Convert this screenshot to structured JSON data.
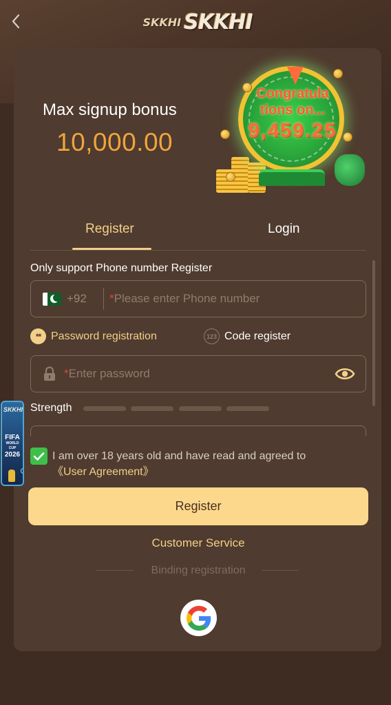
{
  "header": {
    "logo_text": "SKKHI",
    "logo_mini": "SKKHI"
  },
  "bonus": {
    "title": "Max signup bonus",
    "amount": "10,000.00",
    "promo_line1": "Congratula",
    "promo_line2": "tions on...",
    "promo_amount": "9,459.25"
  },
  "tabs": [
    {
      "label": "Register",
      "active": true
    },
    {
      "label": "Login",
      "active": false
    }
  ],
  "form": {
    "support_text": "Only support Phone number Register",
    "country_code": "+92",
    "phone_placeholder": "Please enter Phone number",
    "mode_password_label": "Password registration",
    "mode_password_icon": "**",
    "mode_code_label": "Code register",
    "mode_code_icon": "123",
    "password_placeholder": "Enter password",
    "strength_label": "Strength",
    "strength_level": 0
  },
  "agreement": {
    "checked": true,
    "text": "I am over 18 years old and have read and agreed to",
    "link": "《User Agreement》"
  },
  "actions": {
    "register_label": "Register",
    "customer_service": "Customer Service",
    "binding_label": "Binding registration"
  },
  "float_badge": {
    "logo": "SKKHI",
    "fifa_line1": "FIFA",
    "fifa_line2": "WORLD CUP",
    "fifa_year": "2026"
  },
  "icons": {
    "back": "chevron-left-icon",
    "lock": "lock-icon",
    "eye": "eye-icon",
    "check": "check-icon",
    "google": "google-icon",
    "flag": "pakistan-flag-icon"
  },
  "colors": {
    "accent": "#f2d089",
    "bonus": "#f0a53c",
    "button": "#fcd88c",
    "card": "#4f3b2f",
    "background": "#3e2c22",
    "check": "#3fbf4a",
    "required": "#e0453a"
  }
}
